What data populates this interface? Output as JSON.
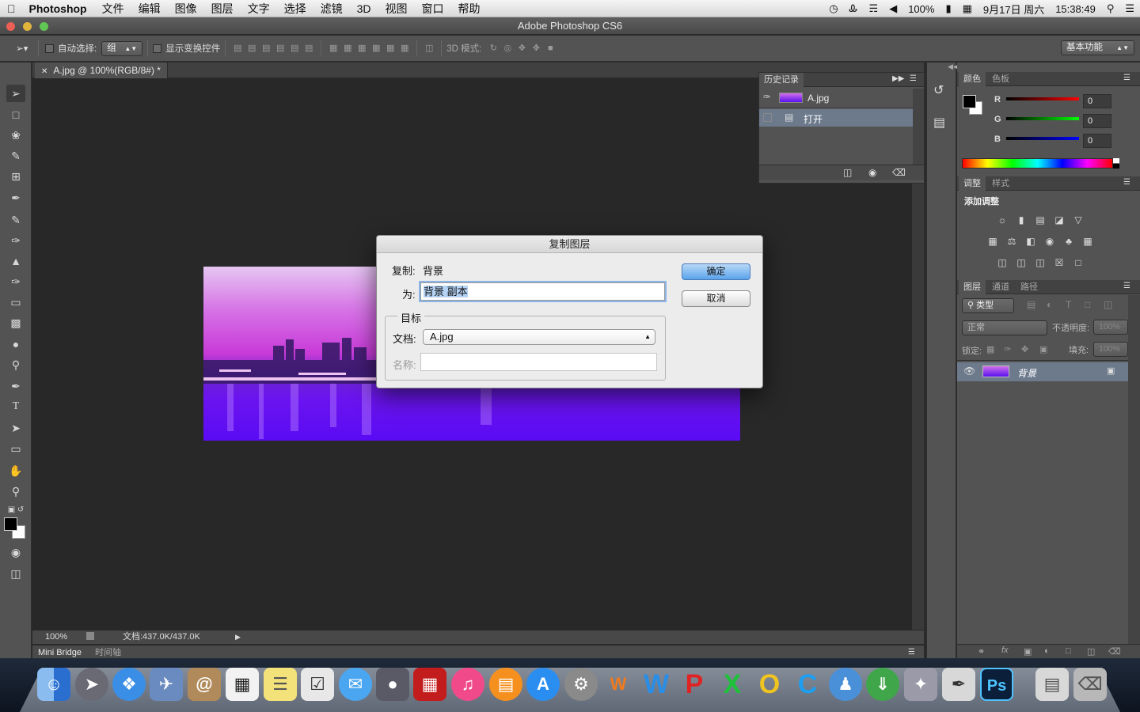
{
  "menubar": {
    "app": "Photoshop",
    "menus": [
      "文件",
      "编辑",
      "图像",
      "图层",
      "文字",
      "选择",
      "滤镜",
      "3D",
      "视图",
      "窗口",
      "帮助"
    ],
    "battery": "100%",
    "date": "9月17日 周六",
    "time": "15:38:49"
  },
  "window": {
    "title": "Adobe Photoshop CS6"
  },
  "options": {
    "auto_select_label": "自动选择:",
    "auto_select_value": "组",
    "show_transform_label": "显示变换控件",
    "mode_3d_label": "3D 模式:",
    "workspace": "基本功能"
  },
  "document": {
    "tab_title": "A.jpg @ 100%(RGB/8#) *",
    "zoom": "100%",
    "doc_size": "文档:437.0K/437.0K"
  },
  "bottom_tabs": [
    "Mini Bridge",
    "时间轴"
  ],
  "history_panel": {
    "title": "历史记录",
    "snapshot": "A.jpg",
    "steps": [
      "打开"
    ]
  },
  "color_panel": {
    "tabs": [
      "颜色",
      "色板"
    ],
    "r_label": "R",
    "g_label": "G",
    "b_label": "B",
    "r": "0",
    "g": "0",
    "b": "0"
  },
  "adjust_panel": {
    "tabs": [
      "调整",
      "样式"
    ],
    "heading": "添加调整"
  },
  "layers_panel": {
    "tabs": [
      "图层",
      "通道",
      "路径"
    ],
    "filter": "类型",
    "blend_mode": "正常",
    "opacity_label": "不透明度:",
    "opacity": "100%",
    "lock_label": "锁定:",
    "fill_label": "填充:",
    "fill": "100%",
    "layers": [
      {
        "name": "背景"
      }
    ]
  },
  "dialog": {
    "title": "复制图层",
    "dup_label": "复制:",
    "dup_value": "背景",
    "as_label": "为:",
    "as_value": "背景 副本",
    "target_group": "目标",
    "doc_label": "文档:",
    "doc_value": "A.jpg",
    "name_label": "名称:",
    "name_value": "",
    "ok": "确定",
    "cancel": "取消"
  },
  "colors": {
    "accent": "#3d8ee8",
    "panel": "#535353",
    "canvas": "#282828"
  }
}
